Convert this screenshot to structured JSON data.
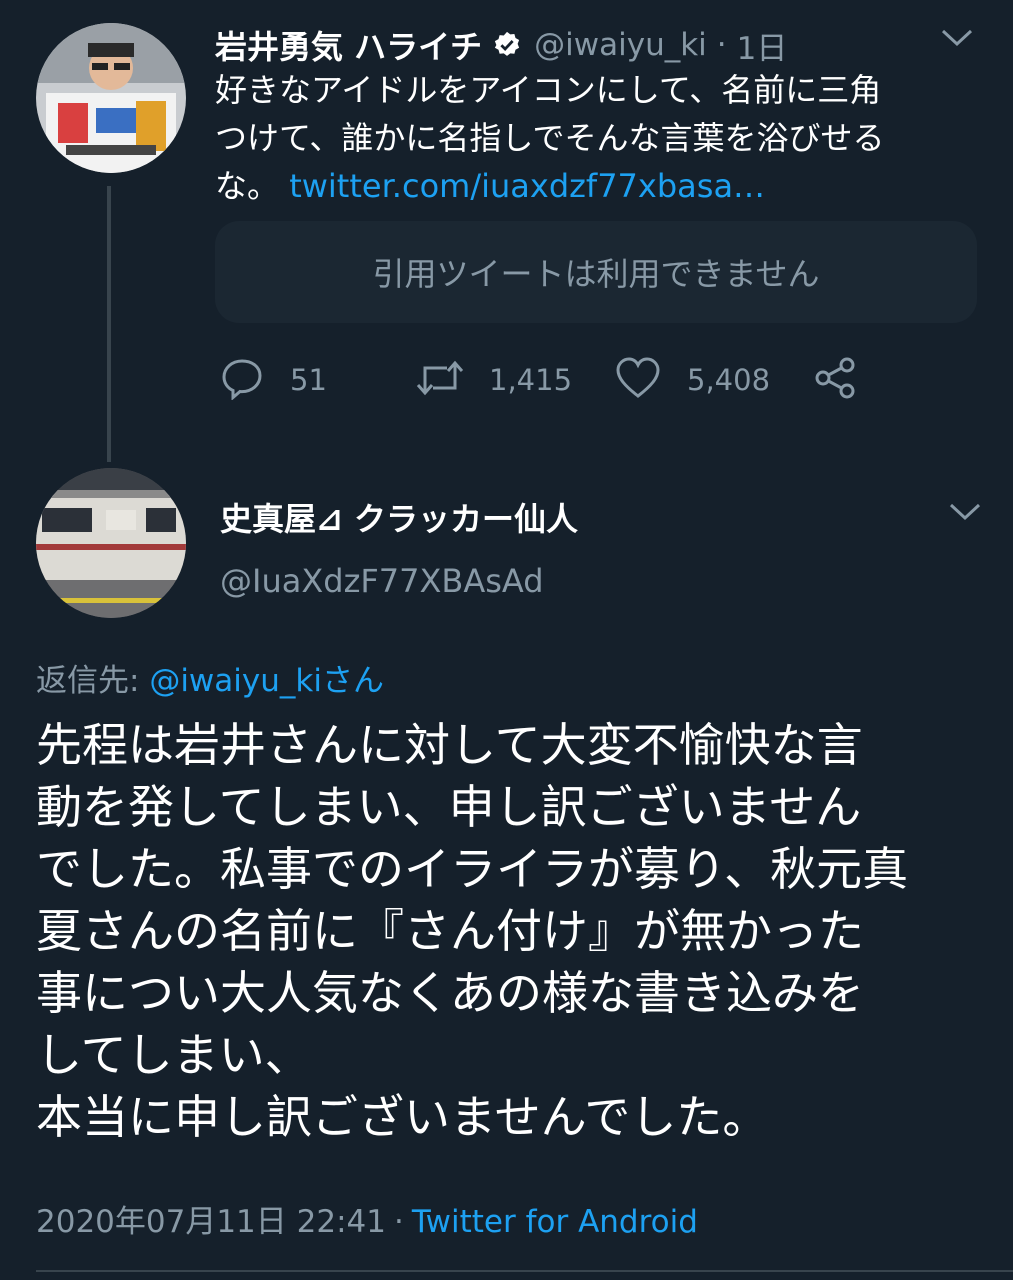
{
  "tweet1": {
    "name": "岩井勇気 ハライチ",
    "handle": "@iwaiyu_ki",
    "separator": "·",
    "time": "1日",
    "text_lines": [
      "好きなアイドルをアイコンにして、名前に三角",
      "つけて、誰かに名指しでそんな言葉を浴びせる",
      "な。"
    ],
    "link": "twitter.com/iuaxdzf77xbasa…",
    "quote_unavailable": "引用ツイートは利用できません",
    "replies": "51",
    "retweets": "1,415",
    "likes": "5,408"
  },
  "tweet2": {
    "name": "史真屋⊿ クラッカー仙人",
    "handle": "@IuaXdzF77XBAsAd",
    "reply_label": "返信先: ",
    "reply_target": "@iwaiyu_kiさん",
    "body_lines": [
      "先程は岩井さんに対して大変不愉快な言",
      "動を発してしまい、申し訳ございません",
      "でした。私事でのイライラが募り、秋元真",
      "夏さんの名前に『さん付け』が無かった",
      "事につい大人気なくあの様な書き込みを",
      "してしまい、",
      "本当に申し訳ございませんでした。"
    ],
    "date": "2020年07月11日 22:41",
    "separator": "·",
    "client": "Twitter for Android"
  },
  "colors": {
    "background": "#15202b",
    "secondary_text": "#8899a6",
    "link": "#1da1f2",
    "divider": "#38444d"
  },
  "icons": [
    "verified-badge-icon",
    "chevron-down-icon",
    "reply-icon",
    "retweet-icon",
    "like-icon",
    "share-icon"
  ]
}
